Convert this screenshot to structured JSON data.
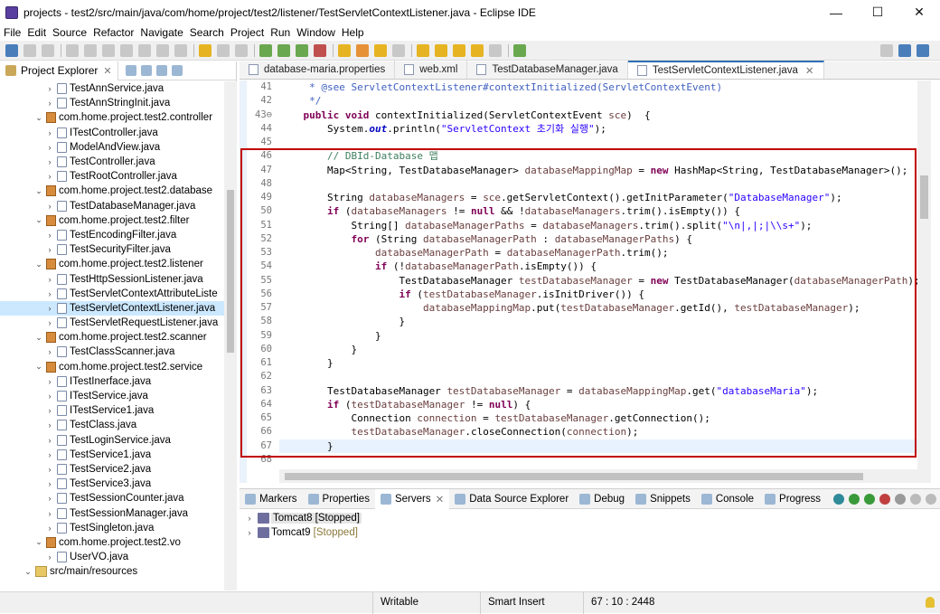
{
  "window": {
    "title": "projects - test2/src/main/java/com/home/project/test2/listener/TestServletContextListener.java - Eclipse IDE",
    "controls": [
      "—",
      "☐",
      "✕"
    ]
  },
  "menu": [
    "File",
    "Edit",
    "Source",
    "Refactor",
    "Navigate",
    "Search",
    "Project",
    "Run",
    "Window",
    "Help"
  ],
  "explorer": {
    "tab_label": "Project Explorer",
    "tree": [
      {
        "indent": 4,
        "twisty": "›",
        "icon": "java",
        "label": "TestAnnService.java"
      },
      {
        "indent": 4,
        "twisty": "›",
        "icon": "java",
        "label": "TestAnnStringInit.java"
      },
      {
        "indent": 3,
        "twisty": "⌄",
        "icon": "pkg",
        "label": "com.home.project.test2.controller"
      },
      {
        "indent": 4,
        "twisty": "›",
        "icon": "java",
        "label": "ITestController.java"
      },
      {
        "indent": 4,
        "twisty": "›",
        "icon": "java",
        "label": "ModelAndView.java"
      },
      {
        "indent": 4,
        "twisty": "›",
        "icon": "java",
        "label": "TestController.java"
      },
      {
        "indent": 4,
        "twisty": "›",
        "icon": "java",
        "label": "TestRootController.java"
      },
      {
        "indent": 3,
        "twisty": "⌄",
        "icon": "pkg",
        "label": "com.home.project.test2.database"
      },
      {
        "indent": 4,
        "twisty": "›",
        "icon": "java",
        "label": "TestDatabaseManager.java"
      },
      {
        "indent": 3,
        "twisty": "⌄",
        "icon": "pkg",
        "label": "com.home.project.test2.filter"
      },
      {
        "indent": 4,
        "twisty": "›",
        "icon": "java",
        "label": "TestEncodingFilter.java"
      },
      {
        "indent": 4,
        "twisty": "›",
        "icon": "java",
        "label": "TestSecurityFilter.java"
      },
      {
        "indent": 3,
        "twisty": "⌄",
        "icon": "pkg",
        "label": "com.home.project.test2.listener"
      },
      {
        "indent": 4,
        "twisty": "›",
        "icon": "java",
        "label": "TestHttpSessionListener.java"
      },
      {
        "indent": 4,
        "twisty": "›",
        "icon": "java",
        "label": "TestServletContextAttributeListe"
      },
      {
        "indent": 4,
        "twisty": "›",
        "icon": "java",
        "label": "TestServletContextListener.java",
        "selected": true
      },
      {
        "indent": 4,
        "twisty": "›",
        "icon": "java",
        "label": "TestServletRequestListener.java"
      },
      {
        "indent": 3,
        "twisty": "⌄",
        "icon": "pkg",
        "label": "com.home.project.test2.scanner"
      },
      {
        "indent": 4,
        "twisty": "›",
        "icon": "java",
        "label": "TestClassScanner.java"
      },
      {
        "indent": 3,
        "twisty": "⌄",
        "icon": "pkg",
        "label": "com.home.project.test2.service"
      },
      {
        "indent": 4,
        "twisty": "›",
        "icon": "java",
        "label": "ITestInerface.java"
      },
      {
        "indent": 4,
        "twisty": "›",
        "icon": "java",
        "label": "ITestService.java"
      },
      {
        "indent": 4,
        "twisty": "›",
        "icon": "java",
        "label": "ITestService1.java"
      },
      {
        "indent": 4,
        "twisty": "›",
        "icon": "java",
        "label": "TestClass.java"
      },
      {
        "indent": 4,
        "twisty": "›",
        "icon": "java",
        "label": "TestLoginService.java"
      },
      {
        "indent": 4,
        "twisty": "›",
        "icon": "java",
        "label": "TestService1.java"
      },
      {
        "indent": 4,
        "twisty": "›",
        "icon": "java",
        "label": "TestService2.java"
      },
      {
        "indent": 4,
        "twisty": "›",
        "icon": "java",
        "label": "TestService3.java"
      },
      {
        "indent": 4,
        "twisty": "›",
        "icon": "java",
        "label": "TestSessionCounter.java"
      },
      {
        "indent": 4,
        "twisty": "›",
        "icon": "java",
        "label": "TestSessionManager.java"
      },
      {
        "indent": 4,
        "twisty": "›",
        "icon": "java",
        "label": "TestSingleton.java"
      },
      {
        "indent": 3,
        "twisty": "⌄",
        "icon": "pkg",
        "label": "com.home.project.test2.vo"
      },
      {
        "indent": 4,
        "twisty": "›",
        "icon": "java",
        "label": "UserVO.java"
      },
      {
        "indent": 2,
        "twisty": "⌄",
        "icon": "fold",
        "label": "src/main/resources"
      }
    ]
  },
  "editor": {
    "tabs": [
      {
        "label": "database-maria.properties",
        "active": false
      },
      {
        "label": "web.xml",
        "active": false
      },
      {
        "label": "TestDatabaseManager.java",
        "active": false
      },
      {
        "label": "TestServletContextListener.java",
        "active": true
      }
    ],
    "lines": [
      {
        "n": "41",
        "html": "     <span class=\"cm\">* @see ServletContextListener#contextInitialized(ServletContextEvent)</span>"
      },
      {
        "n": "42",
        "html": "     <span class=\"cm\">*/</span>"
      },
      {
        "n": "43⊖",
        "html": "    <span class=\"kw\">public</span> <span class=\"kw\">void</span> contextInitialized(ServletContextEvent <span class=\"vr\">sce</span>)  {"
      },
      {
        "n": "44",
        "html": "        System.<span class=\"fld\">out</span>.println(<span class=\"st\">\"ServletContext 초기화 실행\"</span>);"
      },
      {
        "n": "45",
        "html": ""
      },
      {
        "n": "46",
        "html": "        <span class=\"cmt\">// DBId-Database 맵</span>"
      },
      {
        "n": "47",
        "html": "        Map&lt;String, TestDatabaseManager&gt; <span class=\"vr\">databaseMappingMap</span> = <span class=\"kw\">new</span> HashMap&lt;String, TestDatabaseManager&gt;();"
      },
      {
        "n": "48",
        "html": ""
      },
      {
        "n": "49",
        "html": "        String <span class=\"vr\">databaseManagers</span> = <span class=\"vr\">sce</span>.getServletContext().getInitParameter(<span class=\"st\">\"DatabaseManager\"</span>);"
      },
      {
        "n": "50",
        "html": "        <span class=\"kw\">if</span> (<span class=\"vr\">databaseManagers</span> != <span class=\"kw\">null</span> &amp;&amp; !<span class=\"vr\">databaseManagers</span>.trim().isEmpty()) {"
      },
      {
        "n": "51",
        "html": "            String[] <span class=\"vr\">databaseManagerPaths</span> = <span class=\"vr\">databaseManagers</span>.trim().split(<span class=\"st\">\"\\n|,|;|\\\\s+\"</span>);"
      },
      {
        "n": "52",
        "html": "            <span class=\"kw\">for</span> (String <span class=\"vr\">databaseManagerPath</span> : <span class=\"vr\">databaseManagerPaths</span>) {"
      },
      {
        "n": "53",
        "html": "                <span class=\"vr\">databaseManagerPath</span> = <span class=\"vr\">databaseManagerPath</span>.trim();"
      },
      {
        "n": "54",
        "html": "                <span class=\"kw\">if</span> (!<span class=\"vr\">databaseManagerPath</span>.isEmpty()) {"
      },
      {
        "n": "55",
        "html": "                    TestDatabaseManager <span class=\"vr\">testDatabaseManager</span> = <span class=\"kw\">new</span> TestDatabaseManager(<span class=\"vr\">databaseManagerPath</span>);"
      },
      {
        "n": "56",
        "html": "                    <span class=\"kw\">if</span> (<span class=\"vr\">testDatabaseManager</span>.isInitDriver()) {"
      },
      {
        "n": "57",
        "html": "                        <span class=\"vr\">databaseMappingMap</span>.put(<span class=\"vr\">testDatabaseManager</span>.getId(), <span class=\"vr\">testDatabaseManager</span>);"
      },
      {
        "n": "58",
        "html": "                    }"
      },
      {
        "n": "59",
        "html": "                }"
      },
      {
        "n": "60",
        "html": "            }"
      },
      {
        "n": "61",
        "html": "        }"
      },
      {
        "n": "62",
        "html": ""
      },
      {
        "n": "63",
        "html": "        TestDatabaseManager <span class=\"vr\">testDatabaseManager</span> = <span class=\"vr\">databaseMappingMap</span>.get(<span class=\"st\">\"databaseMaria\"</span>);"
      },
      {
        "n": "64",
        "html": "        <span class=\"kw\">if</span> (<span class=\"vr\">testDatabaseManager</span> != <span class=\"kw\">null</span>) {"
      },
      {
        "n": "65",
        "html": "            Connection <span class=\"vr\">connection</span> = <span class=\"vr\">testDatabaseManager</span>.getConnection();"
      },
      {
        "n": "66",
        "html": "            <span class=\"vr\">testDatabaseManager</span>.closeConnection(<span class=\"vr\">connection</span>);"
      },
      {
        "n": "67",
        "html": "        }",
        "current": true
      },
      {
        "n": "68",
        "html": ""
      }
    ]
  },
  "bottom_panel": {
    "tabs": [
      {
        "label": "Markers",
        "active": false
      },
      {
        "label": "Properties",
        "active": false
      },
      {
        "label": "Servers",
        "active": true
      },
      {
        "label": "Data Source Explorer",
        "active": false
      },
      {
        "label": "Debug",
        "active": false
      },
      {
        "label": "Snippets",
        "active": false
      },
      {
        "label": "Console",
        "active": false
      },
      {
        "label": "Progress",
        "active": false
      }
    ],
    "servers": [
      {
        "name": "Tomcat8",
        "state": "[Stopped]",
        "selected": true
      },
      {
        "name": "Tomcat9",
        "state": "[Stopped]",
        "selected": false
      }
    ]
  },
  "status": {
    "mode": "Writable",
    "insert": "Smart Insert",
    "position": "67 : 10 : 2448"
  },
  "colors": {
    "highlight_box": "#c00000",
    "selection": "#cce8ff"
  }
}
